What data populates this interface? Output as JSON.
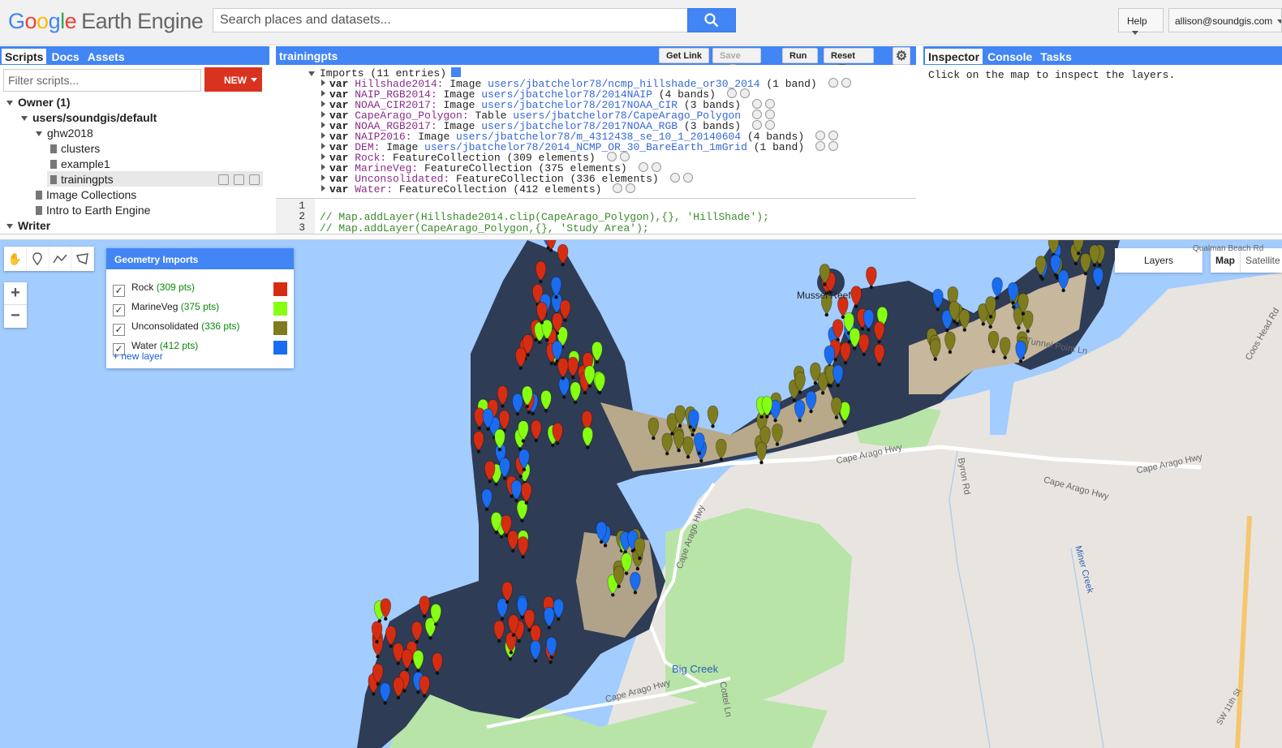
{
  "header": {
    "logo_google": [
      "G",
      "o",
      "o",
      "g",
      "l",
      "e"
    ],
    "logo_product": "Earth Engine",
    "search_placeholder": "Search places and datasets...",
    "help_label": "Help",
    "user_label": "allison@soundgis.com"
  },
  "left_panel": {
    "tabs": [
      "Scripts",
      "Docs",
      "Assets"
    ],
    "active_tab": "Scripts",
    "filter_placeholder": "Filter scripts...",
    "new_button": "NEW",
    "tree": {
      "owner": "Owner (1)",
      "repo": "users/soundgis/default",
      "folder": "ghw2018",
      "files": [
        "clusters",
        "example1",
        "trainingpts"
      ],
      "selected_file": "trainingpts",
      "other_items": [
        "Image Collections",
        "Intro to Earth Engine"
      ],
      "writer": "Writer"
    }
  },
  "editor": {
    "script_name": "trainingpts",
    "buttons": {
      "get_link": "Get Link",
      "save": "Save",
      "run": "Run",
      "reset": "Reset"
    },
    "imports_header": "Imports (11 entries)",
    "imports": [
      {
        "kw": "var",
        "name": "Hillshade2014:",
        "type": "Image",
        "path": "users/jbatchelor78/ncmp_hillshade_or30_2014",
        "extra": "(1 band)"
      },
      {
        "kw": "var",
        "name": "NAIP_RGB2014:",
        "type": "Image",
        "path": "users/jbatchelor78/2014NAIP",
        "extra": "(4 bands)"
      },
      {
        "kw": "var",
        "name": "NOAA_CIR2017:",
        "type": "Image",
        "path": "users/jbatchelor78/2017NOAA_CIR",
        "extra": "(3 bands)"
      },
      {
        "kw": "var",
        "name": "CapeArago_Polygon:",
        "type": "Table",
        "path": "users/jbatchelor78/CapeArago_Polygon",
        "extra": ""
      },
      {
        "kw": "var",
        "name": "NOAA_RGB2017:",
        "type": "Image",
        "path": "users/jbatchelor78/2017NOAA_RGB",
        "extra": "(3 bands)"
      },
      {
        "kw": "var",
        "name": "NAIP2016:",
        "type": "Image",
        "path": "users/jbatchelor78/m_4312438_se_10_1_20140604",
        "extra": "(4 bands)"
      },
      {
        "kw": "var",
        "name": "DEM:",
        "type": "Image",
        "path": "users/jbatchelor78/2014_NCMP_OR_30_BareEarth_1mGrid",
        "extra": "(1 band)"
      },
      {
        "kw": "var",
        "name": "Rock:",
        "type": "FeatureCollection",
        "path": "",
        "extra": "(309 elements)"
      },
      {
        "kw": "var",
        "name": "MarineVeg:",
        "type": "FeatureCollection",
        "path": "",
        "extra": "(375 elements)"
      },
      {
        "kw": "var",
        "name": "Unconsolidated:",
        "type": "FeatureCollection",
        "path": "",
        "extra": "(336 elements)"
      },
      {
        "kw": "var",
        "name": "Water:",
        "type": "FeatureCollection",
        "path": "",
        "extra": "(412 elements)"
      }
    ],
    "line_numbers": [
      "1",
      "2",
      "3"
    ],
    "code_lines": [
      "",
      "// Map.addLayer(Hillshade2014.clip(CapeArago_Polygon),{}, 'HillShade');",
      "// Map.addLayer(CapeArago_Polygon,{}, 'Study Area');"
    ]
  },
  "right_panel": {
    "tabs": [
      "Inspector",
      "Console",
      "Tasks"
    ],
    "active_tab": "Inspector",
    "message": "Click on the map to inspect the layers."
  },
  "map": {
    "geometry_imports_title": "Geometry Imports",
    "layers": [
      {
        "name": "Rock",
        "count": "(309 pts)",
        "color": "#d52d12"
      },
      {
        "name": "MarineVeg",
        "count": "(375 pts)",
        "color": "#86ff12"
      },
      {
        "name": "Unconsolidated",
        "count": "(336 pts)",
        "color": "#7e7c1f"
      },
      {
        "name": "Water",
        "count": "(412 pts)",
        "color": "#1a6cf0"
      }
    ],
    "new_layer": "+ new layer",
    "layers_button": "Layers",
    "map_types": [
      "Map",
      "Satellite"
    ],
    "active_map_type": "Map",
    "zoom_in": "+",
    "zoom_out": "−",
    "place_labels": [
      "Mussel Reef",
      "Big Creek",
      "Cape Arago Hwy",
      "Cape Arago Hwy",
      "Cape Arago Hwy",
      "Cape Arago Hwy",
      "Miner Creek",
      "Coos Head Rd",
      "Byron Rd",
      "Tunnel Point Ln",
      "Cape Arago Hwy",
      "Cottel Ln",
      "Qualman Beach Rd",
      "SW 11th St"
    ]
  }
}
